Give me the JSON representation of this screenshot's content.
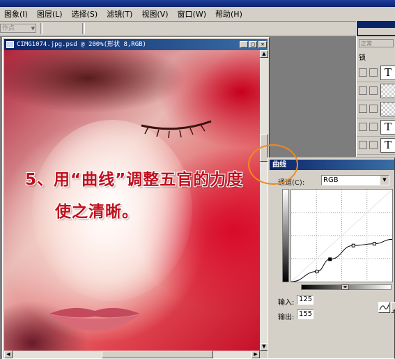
{
  "menu": {
    "items": [
      "图象(I)",
      "图层(L)",
      "选择(S)",
      "滤镜(T)",
      "视图(V)",
      "窗口(W)",
      "帮助(H)"
    ]
  },
  "options": {
    "mode_value": "作点"
  },
  "document": {
    "title": "CIMG1074.jpg.psd @ 200%(形状 8,RGB)",
    "caption_line1": "5、用“曲线”调整五官的力度",
    "caption_line2": "使之清晰。"
  },
  "layers_panel": {
    "blend_mode": "正常",
    "lock_label": "锁",
    "layers": [
      {
        "thumb": "T",
        "checker": false
      },
      {
        "thumb": "",
        "checker": true
      },
      {
        "thumb": "",
        "checker": true
      },
      {
        "thumb": "T",
        "checker": false
      },
      {
        "thumb": "T",
        "checker": false
      }
    ]
  },
  "curves": {
    "title": "曲线",
    "channel_label": "通道(C):",
    "channel_value": "RGB",
    "input_label": "输入:",
    "input_value": "125",
    "output_label": "输出:",
    "output_value": "155",
    "points": [
      [
        0,
        0
      ],
      [
        65,
        28
      ],
      [
        98,
        62
      ],
      [
        157,
        100
      ],
      [
        210,
        105
      ],
      [
        255,
        117
      ]
    ]
  },
  "colors": {
    "caption": "#c0101e",
    "highlight_ring": "#f08a1c",
    "title_bar": "#0a246a"
  },
  "icons": {
    "close": "close-icon",
    "minimize": "minimize-icon",
    "maximize": "maximize-icon",
    "dropdown": "chevron-down-icon",
    "eye": "eye-icon",
    "link": "link-icon"
  }
}
